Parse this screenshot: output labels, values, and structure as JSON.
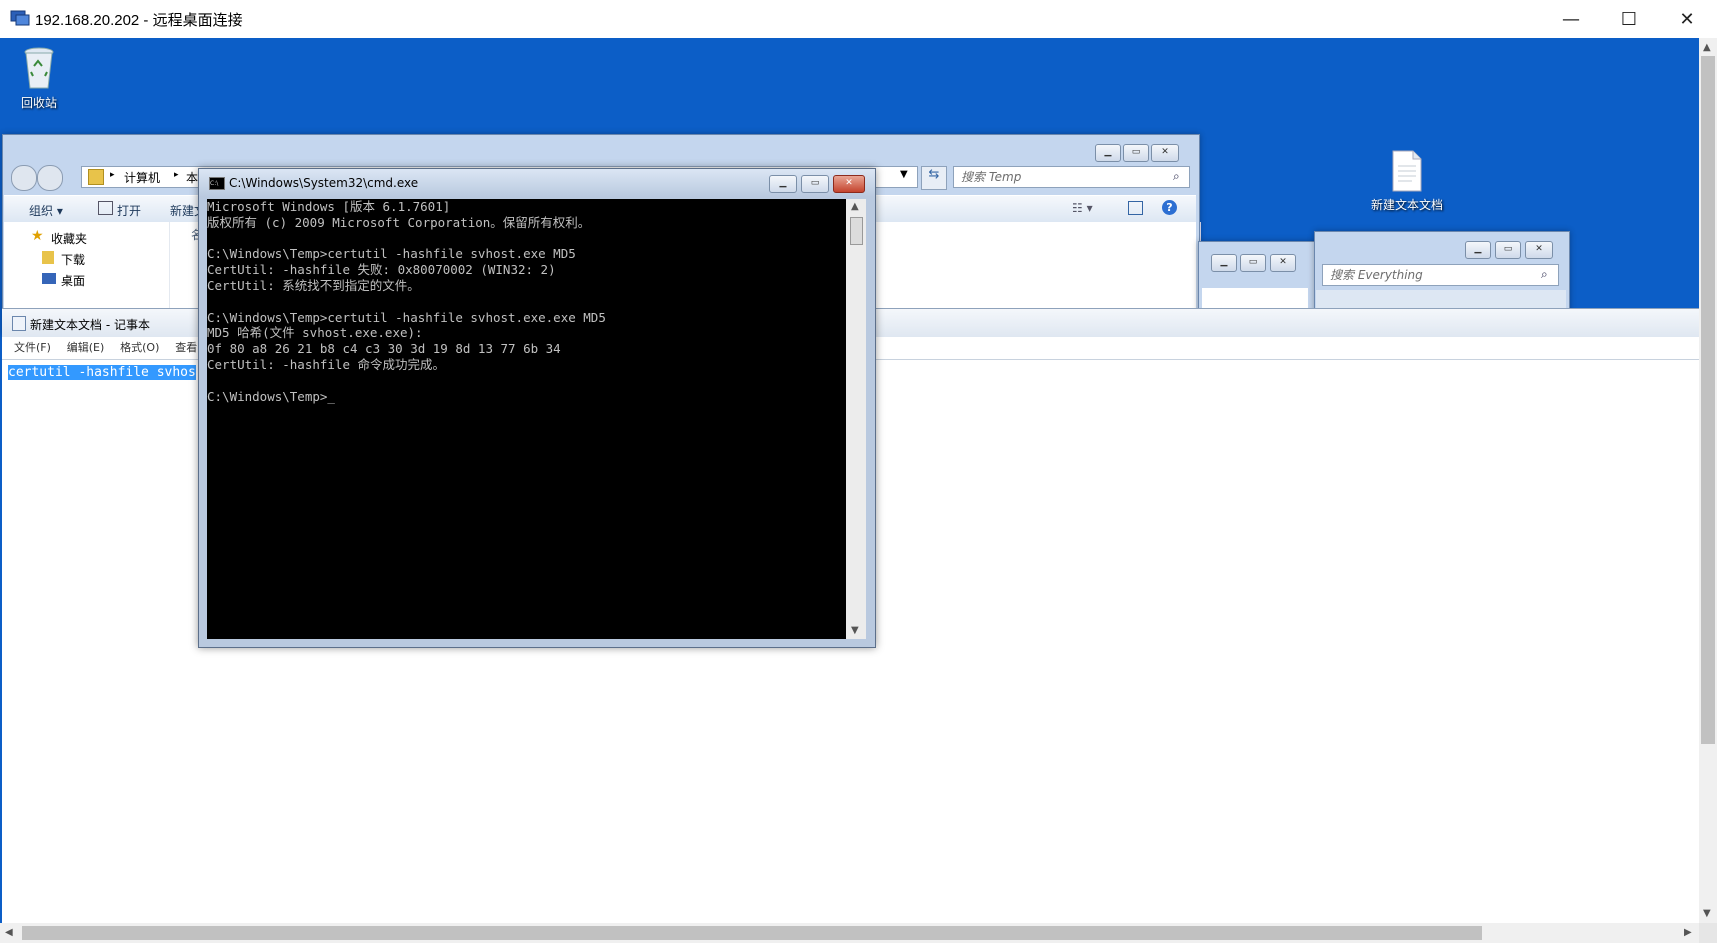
{
  "rdp": {
    "title": "192.168.20.202 - 远程桌面连接",
    "controls": {
      "minimize": "—",
      "maximize": "☐",
      "close": "✕"
    }
  },
  "desktop": {
    "icons": [
      {
        "label": "回收站",
        "icon": "recycle-bin-icon"
      },
      {
        "label": "新建文本文档",
        "icon": "text-document-icon"
      }
    ]
  },
  "explorer": {
    "breadcrumb": [
      "计算机",
      "本"
    ],
    "search_placeholder": "搜索 Temp",
    "toolbar": {
      "organize": "组织 ▾",
      "open": "打开",
      "new": "新建文"
    },
    "nav": [
      "收藏夹",
      "下载",
      "桌面"
    ],
    "col_header": "名"
  },
  "everything": {
    "search_placeholder": "搜索 Everything"
  },
  "notepad": {
    "title": "新建文本文档 - 记事本",
    "menu": [
      "文件(F)",
      "编辑(E)",
      "格式(O)",
      "查看"
    ],
    "selected_text": "certutil -hashfile svhos"
  },
  "cmd": {
    "title": "C:\\Windows\\System32\\cmd.exe",
    "lines": [
      "Microsoft Windows [版本 6.1.7601]",
      "版权所有 (c) 2009 Microsoft Corporation。保留所有权利。",
      "",
      "C:\\Windows\\Temp>certutil -hashfile svhost.exe MD5",
      "CertUtil: -hashfile 失败: 0x80070002 (WIN32: 2)",
      "CertUtil: 系统找不到指定的文件。",
      "",
      "C:\\Windows\\Temp>certutil -hashfile svhost.exe.exe MD5",
      "MD5 哈希(文件 svhost.exe.exe):",
      "0f 80 a8 26 21 b8 c4 c3 30 3d 19 8d 13 77 6b 34",
      "CertUtil: -hashfile 命令成功完成。",
      "",
      "C:\\Windows\\Temp>_"
    ]
  }
}
